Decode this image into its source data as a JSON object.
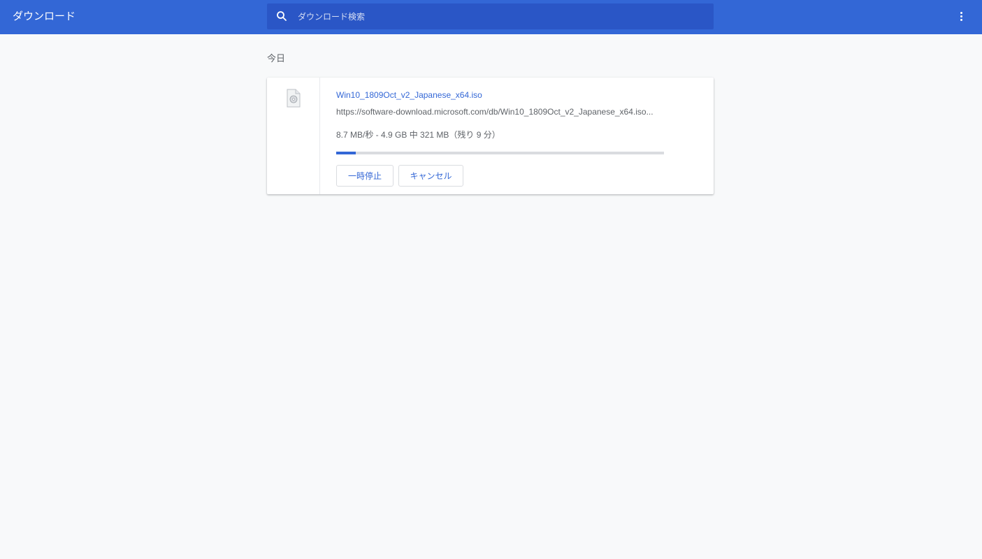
{
  "header": {
    "title": "ダウンロード",
    "search_placeholder": "ダウンロード検索",
    "search_icon": "search-icon",
    "menu_icon": "more-vert-icon"
  },
  "section": {
    "title": "今日"
  },
  "download": {
    "file_icon": "file-icon",
    "file_name": "Win10_1809Oct_v2_Japanese_x64.iso",
    "url": "https://software-download.microsoft.com/db/Win10_1809Oct_v2_Japanese_x64.iso...",
    "status": "8.7 MB/秒 - 4.9 GB 中 321 MB（残り 9 分）",
    "progress_percent": 6,
    "pause_label": "一時停止",
    "cancel_label": "キャンセル"
  },
  "colors": {
    "toolbar": "#3367d6",
    "search_bg": "#2a56c6",
    "accent": "#3367d6",
    "page_bg": "#f8f9fa"
  }
}
